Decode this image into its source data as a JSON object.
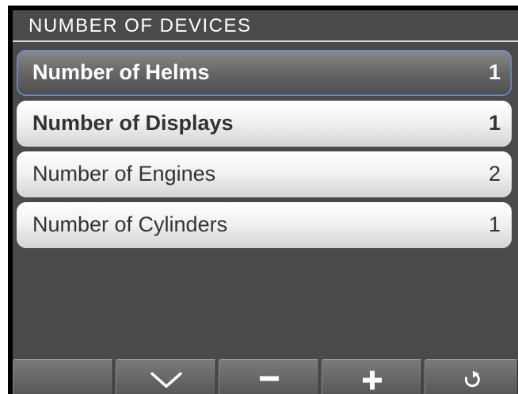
{
  "header": {
    "title": "NUMBER OF DEVICES"
  },
  "menu": {
    "items": [
      {
        "label": "Number of Helms",
        "value": "1",
        "selected": true
      },
      {
        "label": "Number of Displays",
        "value": "1",
        "selected": false
      },
      {
        "label": "Number of Engines",
        "value": "2",
        "selected": false
      },
      {
        "label": "Number of Cylinders",
        "value": "1",
        "selected": false
      }
    ]
  },
  "softkeys": [
    {
      "icon": "blank"
    },
    {
      "icon": "chevron-down-icon"
    },
    {
      "icon": "minus-icon"
    },
    {
      "icon": "plus-icon"
    },
    {
      "icon": "back-arrow-icon"
    }
  ],
  "colors": {
    "background": "#4a4a4a",
    "selection_outline": "#6f8fd8",
    "item_light": "#f2f2f2",
    "text_dark": "#333333",
    "text_light": "#ffffff"
  }
}
